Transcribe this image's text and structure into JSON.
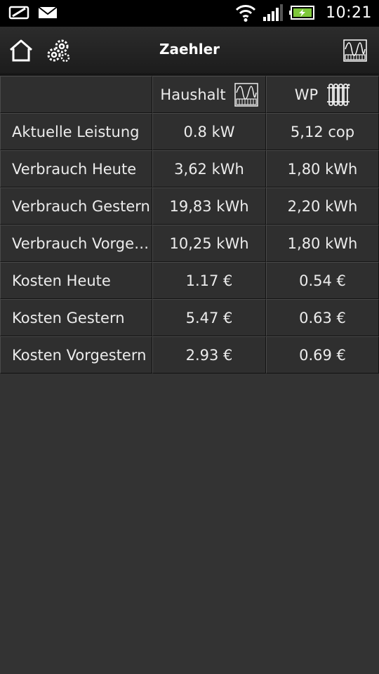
{
  "status_bar": {
    "time": "10:21",
    "left_icons": [
      "notification-icon",
      "mail-icon"
    ],
    "right_icons": [
      "wifi-icon",
      "signal-icon",
      "battery-charging-icon"
    ]
  },
  "action_bar": {
    "title": "Zaehler",
    "icons": [
      "home-icon",
      "gears-icon",
      "meter-icon"
    ]
  },
  "table": {
    "columns": [
      {
        "label": "",
        "icon": ""
      },
      {
        "label": "Haushalt",
        "icon": "meter-icon"
      },
      {
        "label": "WP",
        "icon": "radiator-icon"
      }
    ],
    "rows": [
      {
        "label": "Aktuelle Leistung",
        "haushalt": "0.8 kW",
        "wp": "5,12 cop"
      },
      {
        "label": "Verbrauch Heute",
        "haushalt": "3,62 kWh",
        "wp": "1,80 kWh"
      },
      {
        "label": "Verbrauch Gestern",
        "haushalt": "19,83 kWh",
        "wp": "2,20 kWh"
      },
      {
        "label": "Verbrauch Vorgeste...",
        "haushalt": "10,25 kWh",
        "wp": "1,80 kWh"
      },
      {
        "label": "Kosten Heute",
        "haushalt": "1.17 €",
        "wp": "0.54 €"
      },
      {
        "label": "Kosten Gestern",
        "haushalt": "5.47 €",
        "wp": "0.63 €"
      },
      {
        "label": "Kosten Vorgestern",
        "haushalt": "2.93 €",
        "wp": "0.69 €"
      }
    ]
  },
  "colors": {
    "background": "#333333",
    "cell": "#2f2f2f",
    "status_bar": "#000000",
    "battery_fill": "#7ec83a"
  }
}
